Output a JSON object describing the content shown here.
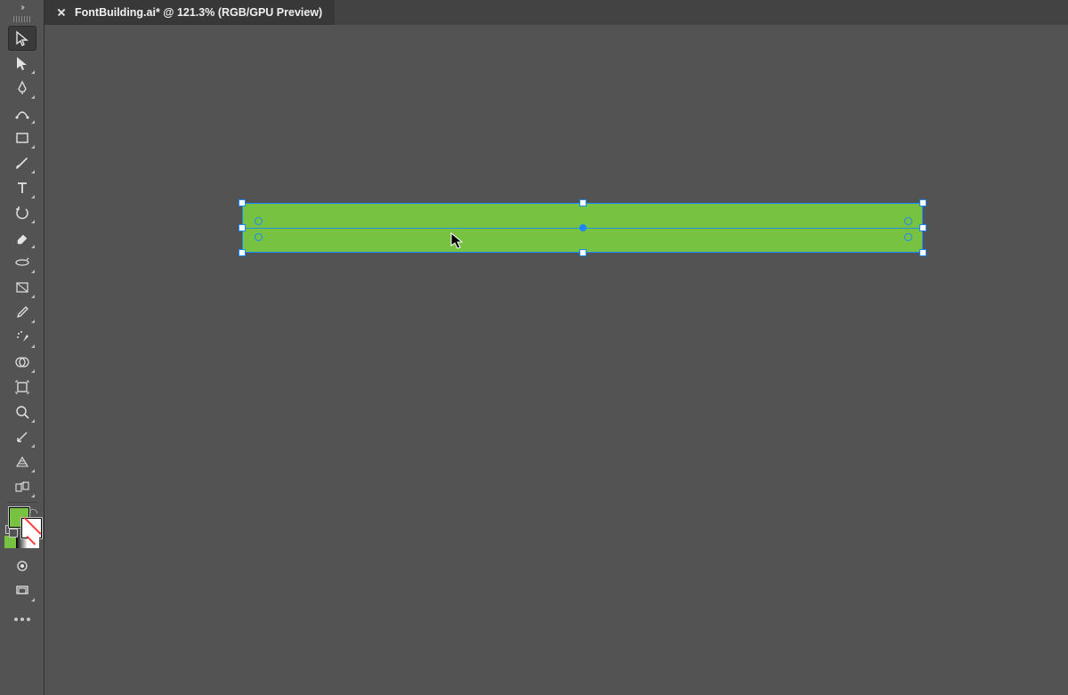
{
  "tab": {
    "title": "FontBuilding.ai* @ 121.3% (RGB/GPU Preview)"
  },
  "toolbar": {
    "tools": [
      {
        "name": "selection-tool",
        "active": true
      },
      {
        "name": "direct-selection-tool"
      },
      {
        "name": "pen-tool"
      },
      {
        "name": "curvature-tool"
      },
      {
        "name": "rectangle-tool"
      },
      {
        "name": "paintbrush-tool"
      },
      {
        "name": "type-tool"
      },
      {
        "name": "rotate-tool"
      },
      {
        "name": "eraser-tool"
      },
      {
        "name": "width-tool"
      },
      {
        "name": "gradient-tool"
      },
      {
        "name": "eyedropper-tool"
      },
      {
        "name": "symbol-sprayer-tool"
      },
      {
        "name": "shape-builder-tool"
      },
      {
        "name": "artboard-tool"
      },
      {
        "name": "zoom-tool"
      },
      {
        "name": "slice-tool"
      },
      {
        "name": "perspective-grid-tool"
      },
      {
        "name": "blend-tool"
      }
    ]
  },
  "colors": {
    "fill": "#78c241",
    "stroke": "none"
  },
  "canvas": {
    "selected_object": "rounded-rectangle",
    "object_fill": "#78c241"
  }
}
